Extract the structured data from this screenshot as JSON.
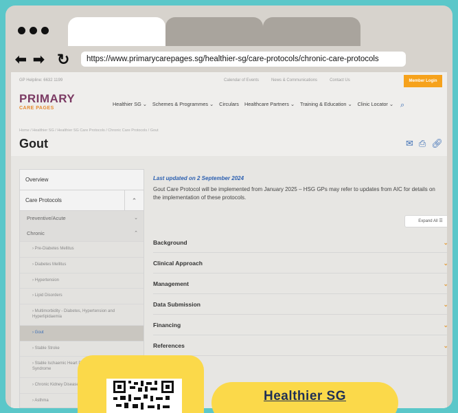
{
  "browser": {
    "url": "https://www.primarycarepages.sg/healthier-sg/care-protocols/chronic-care-protocols",
    "back_icon": "back-arrow-icon",
    "forward_icon": "forward-arrow-icon",
    "reload_icon": "reload-icon"
  },
  "site": {
    "phone": "GP Helpline: 6632 1199",
    "top_links": [
      "Calendar of Events",
      "News & Communications",
      "Contact Us"
    ],
    "login_label": "Member Login",
    "logo_line1": "PRIMARY",
    "logo_line2": "CARE PAGES",
    "nav": [
      "Healthier SG ⌄",
      "Schemes & Programmes ⌄",
      "Circulars",
      "Healthcare Partners ⌄",
      "Training & Education ⌄",
      "Clinic Locator ⌄"
    ],
    "breadcrumb": "Home / Healthier SG / Healthier SG Care Protocols / Chronic Care Protocols / Gout",
    "title": "Gout"
  },
  "sidebar": {
    "overview": "Overview",
    "care_protocols": "Care Protocols",
    "preventive": "Preventive/Acute",
    "chronic": "Chronic",
    "items": [
      "› Pre-Diabetes Mellitus",
      "› Diabetes Mellitus",
      "› Hypertension",
      "› Lipid Disorders",
      "› Multimorbidity - Diabetes, Hypertension and Hyperlipidaemia",
      "› Gout",
      "› Stable Stroke",
      "› Stable Ischaemic Heart Disease / Chronic Coronary Syndrome",
      "› Chronic Kidney Disease",
      "› Asthma"
    ],
    "active_index": 5
  },
  "content": {
    "updated": "Last updated on 2 September 2024",
    "intro": "Gout Care Protocol will be implemented from January 2025 – HSG GPs may refer to updates from AIC for details on the implementation of these protocols.",
    "expand_all": "Expand All  ☰",
    "sections": [
      "Background",
      "Clinical Approach",
      "Management",
      "Data Submission",
      "Financing",
      "References"
    ]
  },
  "overlay": {
    "link_label": "Healthier SG"
  },
  "colors": {
    "background": "#5bc7c9",
    "accent_yellow": "#fbd94a",
    "login_orange": "#f6a21c",
    "link_blue": "#2b5fb0"
  }
}
